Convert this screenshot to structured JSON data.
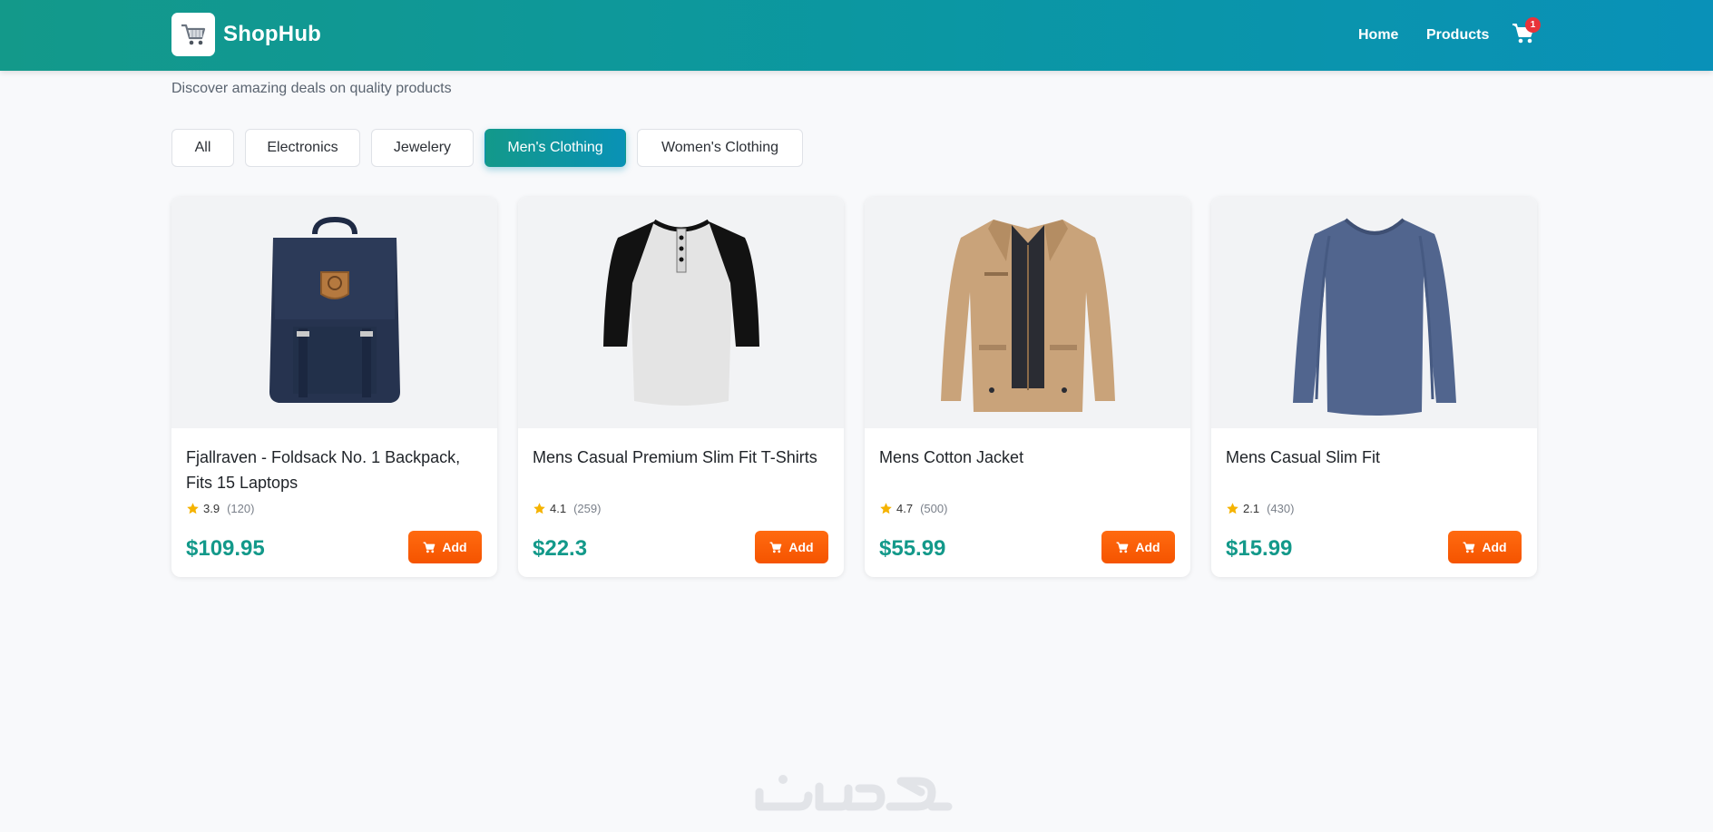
{
  "header": {
    "brand_name": "ShopHub",
    "logo_icon": "shopping-cart-icon",
    "nav": [
      {
        "label": "Home"
      },
      {
        "label": "Products"
      }
    ],
    "cart_icon": "cart-icon",
    "cart_count": "1"
  },
  "subtitle": "Discover amazing deals on quality products",
  "filters": [
    {
      "label": "All",
      "active": false
    },
    {
      "label": "Electronics",
      "active": false
    },
    {
      "label": "Jewelery",
      "active": false
    },
    {
      "label": "Men's Clothing",
      "active": true
    },
    {
      "label": "Women's Clothing",
      "active": false
    }
  ],
  "products": [
    {
      "title": "Fjallraven - Foldsack No. 1 Backpack, Fits 15 Laptops",
      "rating": "3.9",
      "count": "(120)",
      "price": "$109.95",
      "add_label": "Add",
      "image": "backpack"
    },
    {
      "title": "Mens Casual Premium Slim Fit T-Shirts",
      "rating": "4.1",
      "count": "(259)",
      "price": "$22.3",
      "add_label": "Add",
      "image": "henley-shirt"
    },
    {
      "title": "Mens Cotton Jacket",
      "rating": "4.7",
      "count": "(500)",
      "price": "$55.99",
      "add_label": "Add",
      "image": "cotton-jacket"
    },
    {
      "title": "Mens Casual Slim Fit",
      "rating": "2.1",
      "count": "(430)",
      "price": "$15.99",
      "add_label": "Add",
      "image": "long-sleeve-tee"
    }
  ],
  "colors": {
    "header_start": "#13998a",
    "header_end": "#0991b8",
    "price": "#13998a",
    "add_button": "#f55400",
    "badge": "#e8333a",
    "star": "#f5b301"
  },
  "watermark": "خمسات"
}
